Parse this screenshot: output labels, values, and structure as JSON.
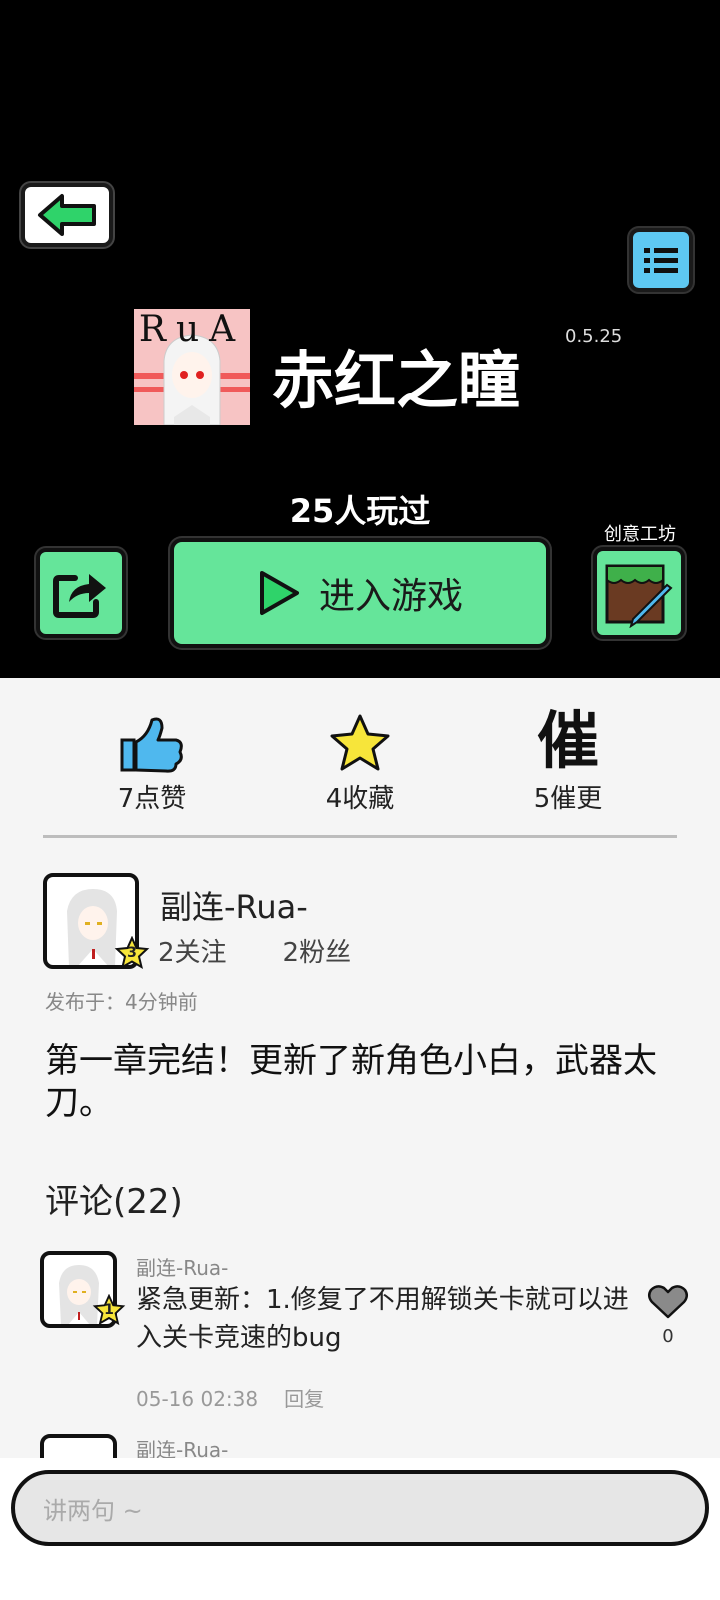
{
  "game": {
    "icon_text": "RuA",
    "title": "赤红之瞳",
    "version": "0.5.25",
    "players": "25人玩过",
    "enter_label": "进入游戏",
    "workshop_label": "创意工坊"
  },
  "stats": {
    "likes": "7点赞",
    "favorites": "4收藏",
    "urge_icon": "催",
    "urges": "5催更"
  },
  "post": {
    "author": "副连-Rua-",
    "level": "3",
    "following": "2关注",
    "followers": "2粉丝",
    "time": "发布于：4分钟前",
    "body": "第一章完结！更新了新角色小白，武器太刀。"
  },
  "comments": {
    "title": "评论(22)",
    "items": [
      {
        "user": "副连-Rua-",
        "level": "1",
        "text": "紧急更新：1.修复了不用解锁关卡就可以进入关卡竞速的bug",
        "time": "05-16 02:38",
        "reply": "回复",
        "likes": "0"
      },
      {
        "user": "副连-Rua-"
      }
    ]
  },
  "input": {
    "placeholder": "讲两句 ~"
  },
  "colors": {
    "header_bg": "#000000",
    "accent_green": "#65e59a",
    "menu_blue": "#5ec8f2",
    "star_yellow": "#f7e53a",
    "like_blue": "#4fb8ee"
  }
}
